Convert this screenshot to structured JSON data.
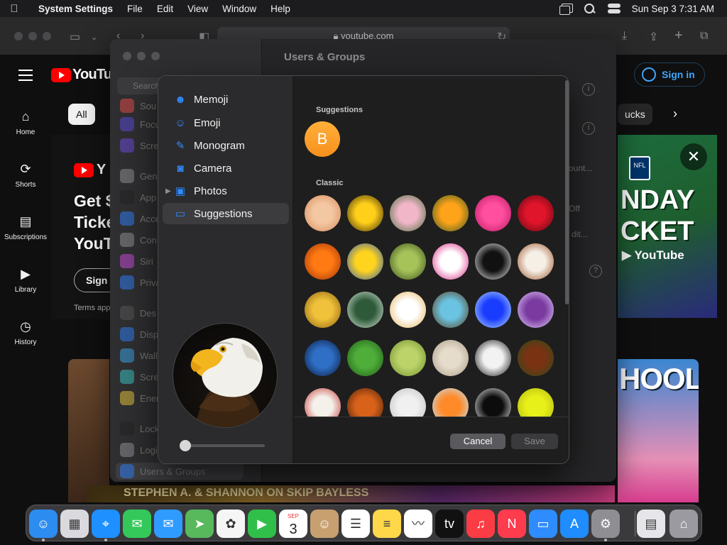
{
  "menubar": {
    "app_name": "System Settings",
    "menus": [
      "File",
      "Edit",
      "View",
      "Window",
      "Help"
    ],
    "datetime": "Sun Sep 3  7:31 AM"
  },
  "safari": {
    "url": "youtube.com"
  },
  "youtube": {
    "logo_text": "YouTube",
    "sign_in": "Sign in",
    "nav": [
      {
        "label": "Home",
        "icon": "home-icon"
      },
      {
        "label": "Shorts",
        "icon": "shorts-icon"
      },
      {
        "label": "Subscriptions",
        "icon": "subscriptions-icon"
      },
      {
        "label": "Library",
        "icon": "library-icon"
      },
      {
        "label": "History",
        "icon": "history-icon"
      }
    ],
    "chip_all": "All",
    "chip_partial": "ucks",
    "promo": {
      "logo_partial": "Y",
      "headline_lines": [
        "Get $",
        "Ticke",
        "YouT"
      ],
      "button_partial": "Sign u",
      "terms_partial": "Terms app"
    },
    "ad_text_lines": [
      "NDAY",
      "CKET"
    ],
    "ad_youtube": "YouTube",
    "ad_badge": "NFL",
    "school_text": "HOOL",
    "thumb_caption": "STEPHEN A. & SHANNON ON SKIP BAYLESS"
  },
  "settings": {
    "title": "Users & Groups",
    "search_placeholder": "Search",
    "sidebar_items": [
      "Sou",
      "Focu",
      "Scre",
      "Gen",
      "App",
      "Acce",
      "Con",
      "Siri",
      "Priva",
      "Des",
      "Disp",
      "Wall",
      "Scre",
      "Ener",
      "Lock",
      "Logi",
      "Users & Groups"
    ],
    "right_controls": {
      "off": "Off",
      "count": "ount...",
      "edit": "dit..."
    }
  },
  "picker": {
    "sources": [
      {
        "label": "Memoji",
        "icon": "memoji-icon",
        "glyph": "☻"
      },
      {
        "label": "Emoji",
        "icon": "emoji-icon",
        "glyph": "☺"
      },
      {
        "label": "Monogram",
        "icon": "monogram-icon",
        "glyph": "✎"
      },
      {
        "label": "Camera",
        "icon": "camera-icon",
        "glyph": "◙"
      },
      {
        "label": "Photos",
        "icon": "photos-icon",
        "glyph": "▣"
      },
      {
        "label": "Suggestions",
        "icon": "folder-icon",
        "glyph": "▭"
      }
    ],
    "selected_source": "Suggestions",
    "suggestions_label": "Suggestions",
    "monogram_letter": "B",
    "classic_label": "Classic",
    "classic_images": [
      "rose-peach",
      "sunflower",
      "lotus",
      "poppy",
      "dahlia",
      "red-rose",
      "orange-flower",
      "sunflower-field",
      "dandelion",
      "lips",
      "yin-yang",
      "gingerbread",
      "gold-coin",
      "chalkboard",
      "fortune-cookie",
      "eggs-nest",
      "snowflake",
      "lightning",
      "earth",
      "leaf",
      "cactus",
      "sand-dollar",
      "zebra",
      "football",
      "baseball",
      "basketball",
      "golf-ball",
      "soccer",
      "eight-ball",
      "tennis-ball"
    ],
    "colors": {
      "rose-peach": [
        "#f3c7a2",
        "#d98a5a"
      ],
      "sunflower": [
        "#ffcf1a",
        "#3a2a0a"
      ],
      "lotus": [
        "#f1b7c9",
        "#4a6b3a"
      ],
      "poppy": [
        "#ffa31a",
        "#3c5a22"
      ],
      "dahlia": [
        "#ff4f9e",
        "#b81862"
      ],
      "red-rose": [
        "#e0142a",
        "#5a0a10"
      ],
      "orange-flower": [
        "#ff7a12",
        "#a03208"
      ],
      "sunflower-field": [
        "#ffd41e",
        "#2f5bb0"
      ],
      "dandelion": [
        "#a6c35a",
        "#3b4d1a"
      ],
      "lips": [
        "#ffffff",
        "#d8207e"
      ],
      "yin-yang": [
        "#111111",
        "#f2f2f2"
      ],
      "gingerbread": [
        "#f5efe6",
        "#9a4f22"
      ],
      "gold-coin": [
        "#f0c13a",
        "#8a6212"
      ],
      "chalkboard": [
        "#2f5a3a",
        "#d8e8d8"
      ],
      "fortune-cookie": [
        "#ffffff",
        "#e2b25a"
      ],
      "eggs-nest": [
        "#6ac3e0",
        "#5a3a1a"
      ],
      "snowflake": [
        "#1a3cff",
        "#b8dcff"
      ],
      "lightning": [
        "#7a3aa0",
        "#e7d2ff"
      ],
      "earth": [
        "#2f6fc6",
        "#0a1a3a"
      ],
      "leaf": [
        "#4fae3a",
        "#1f5a18"
      ],
      "cactus": [
        "#bcd36a",
        "#6f8f2a"
      ],
      "sand-dollar": [
        "#e6dccb",
        "#a89a85"
      ],
      "zebra": [
        "#f2f2f2",
        "#111111"
      ],
      "football": [
        "#7a3312",
        "#2b4a1a"
      ],
      "baseball": [
        "#f4f1ea",
        "#c23030"
      ],
      "basketball": [
        "#d8621a",
        "#4a200a"
      ],
      "golf-ball": [
        "#f0f0f0",
        "#bfbfbf"
      ],
      "soccer": [
        "#ff8a2a",
        "#bfe6f5"
      ],
      "eight-ball": [
        "#0c0c0c",
        "#f2f2f2"
      ],
      "tennis-ball": [
        "#e8f01a",
        "#b0b80f"
      ]
    },
    "cancel": "Cancel",
    "save": "Save"
  },
  "dock": {
    "apps": [
      {
        "name": "finder",
        "glyph": "☺",
        "color": "#2d8cf0"
      },
      {
        "name": "launchpad",
        "glyph": "▦",
        "color": "#d9d9de"
      },
      {
        "name": "safari",
        "glyph": "⌖",
        "color": "#1e90ff"
      },
      {
        "name": "messages",
        "glyph": "✉",
        "color": "#34c759"
      },
      {
        "name": "mail",
        "glyph": "✉",
        "color": "#2f9bff"
      },
      {
        "name": "maps",
        "glyph": "➤",
        "color": "#58b85c"
      },
      {
        "name": "photos",
        "glyph": "✿",
        "color": "#f5f5f5"
      },
      {
        "name": "facetime",
        "glyph": "▶",
        "color": "#30c04a"
      },
      {
        "name": "calendar",
        "glyph": "3",
        "color": "#ffffff"
      },
      {
        "name": "contacts",
        "glyph": "☺",
        "color": "#c8a070"
      },
      {
        "name": "reminders",
        "glyph": "☰",
        "color": "#ffffff"
      },
      {
        "name": "notes",
        "glyph": "≡",
        "color": "#ffd84a"
      },
      {
        "name": "freeform",
        "glyph": "〰",
        "color": "#ffffff"
      },
      {
        "name": "appletv",
        "glyph": "tv",
        "color": "#111111"
      },
      {
        "name": "music",
        "glyph": "♫",
        "color": "#fc3c44"
      },
      {
        "name": "news",
        "glyph": "N",
        "color": "#ff3b4e"
      },
      {
        "name": "keynote",
        "glyph": "▭",
        "color": "#2f8cff"
      },
      {
        "name": "appstore",
        "glyph": "A",
        "color": "#1f8cff"
      },
      {
        "name": "system-settings",
        "glyph": "⚙",
        "color": "#8e8e93"
      },
      {
        "name": "documents",
        "glyph": "▤",
        "color": "#e5e5ea"
      },
      {
        "name": "trash",
        "glyph": "⌂",
        "color": "#9a9aa0"
      }
    ],
    "calendar_month": "SEP",
    "calendar_day": "3",
    "appletv_label": "tv"
  }
}
